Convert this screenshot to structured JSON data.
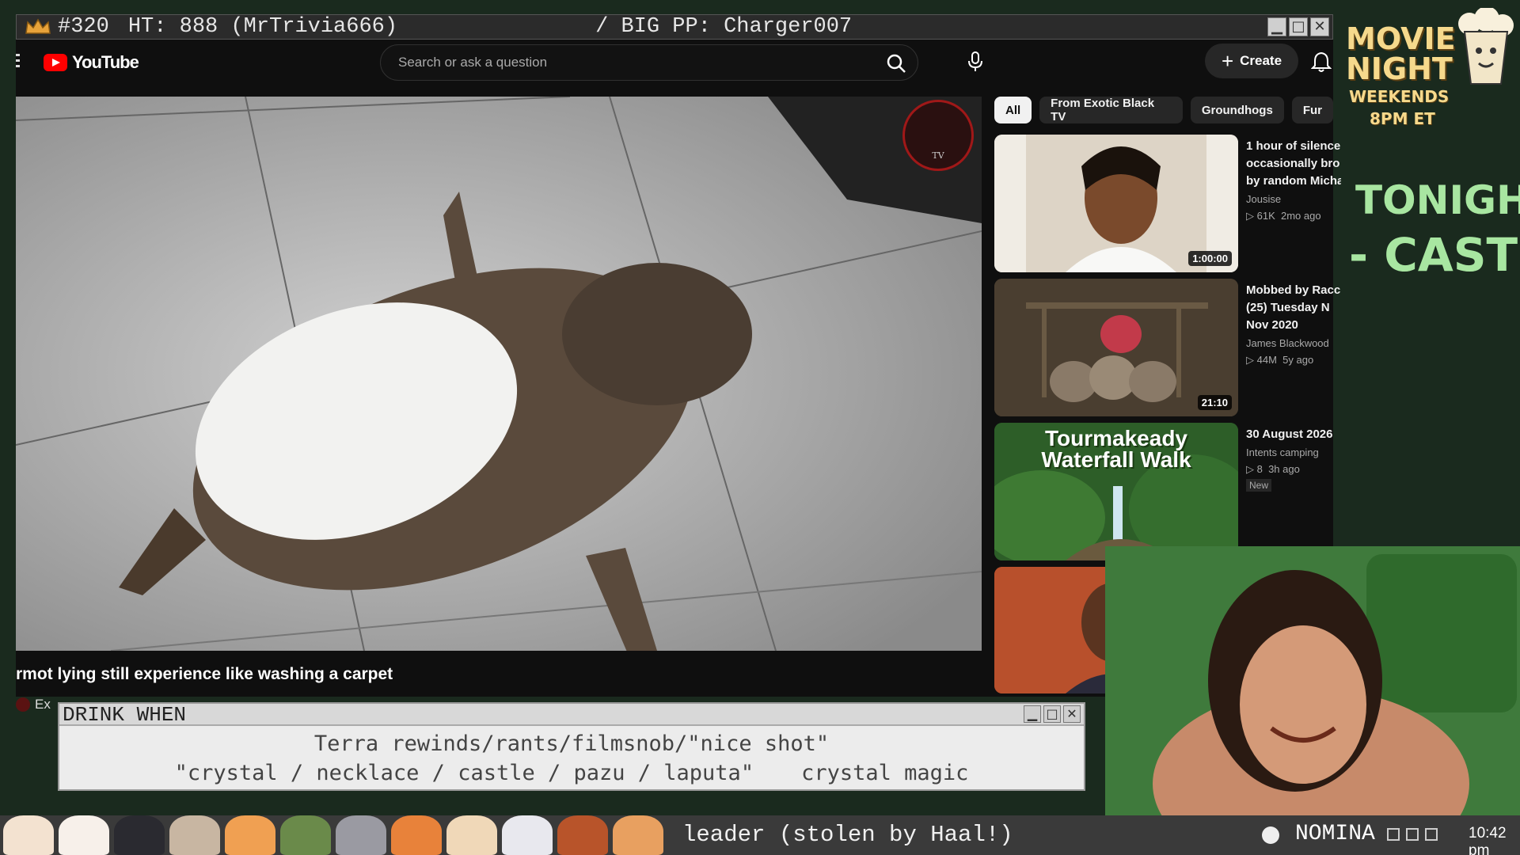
{
  "stream_bar": {
    "rank": "#320",
    "ht": "HT: 888 (MrTrivia666)",
    "pp": "/ BIG PP: Charger007"
  },
  "youtube": {
    "logo_text": "YouTube",
    "search_placeholder": "Search or ask a question",
    "create_label": "Create",
    "chips": [
      "All",
      "From Exotic Black TV",
      "Groundhogs",
      "Fur"
    ],
    "video": {
      "title": "rmot lying still experience like washing a carpet",
      "channel_partial": "Ex",
      "watermark": "TV"
    },
    "recommendations": [
      {
        "title_line1": "1 hour of silence",
        "title_line2": "occasionally bro",
        "title_line3": "by random Micha",
        "channel": "Jousise",
        "views": "61K",
        "age": "2mo ago",
        "duration": "1:00:00"
      },
      {
        "title_line1": "Mobbed by Racc",
        "title_line2": "(25)  Tuesday N",
        "title_line3": "Nov 2020",
        "channel": "James Blackwood",
        "views": "44M",
        "age": "5y ago",
        "duration": "21:10"
      },
      {
        "title_line1": "30 August 2026",
        "title_line2": "",
        "title_line3": "",
        "channel": "Intents camping",
        "views": "8",
        "age": "3h ago",
        "badge": "New",
        "thumb_text_1": "Tourmakeady",
        "thumb_text_2": "Waterfall Walk"
      }
    ]
  },
  "drink_panel": {
    "title": "DRINK WHEN",
    "line1": "Terra rewinds/rants/filmsnob/\"nice shot\"",
    "line2a": "\"crystal / necklace / castle / pazu / laputa\"",
    "line2b": "crystal magic"
  },
  "bottom_bar": {
    "leader": "leader (stolen by Haal!)",
    "nomina": "NOMINA",
    "clock": "10:42 pm"
  },
  "overlay": {
    "movie_line1": "MOVIE",
    "movie_line2": "NIGHT",
    "weekends": "WEEKENDS",
    "time": "8PM ET",
    "tonight": "TONIGHT:",
    "cast": "- CAST"
  },
  "colors": {
    "yt_bg": "#0f0f0f",
    "yt_red": "#ff0000",
    "overlay_green": "#a8e6a1",
    "overlay_gold": "#f6d98c"
  }
}
